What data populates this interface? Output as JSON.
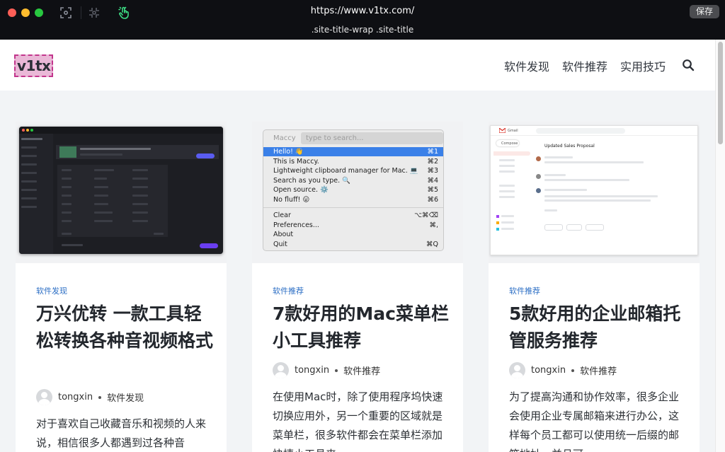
{
  "toolbar": {
    "url": "https://www.v1tx.com/",
    "selector": ".site-title-wrap .site-title",
    "save_label": "保存"
  },
  "site": {
    "logo": "v1tx",
    "nav": [
      "软件发现",
      "软件推荐",
      "实用技巧"
    ]
  },
  "colors": {
    "accent": "#2a6dc4",
    "highlight": "#c2358c",
    "topbar": "#0e0f13"
  },
  "cards": [
    {
      "category": "软件发现",
      "title": "万兴优转 一款工具轻松转换各种音视频格式",
      "author": "tongxin",
      "meta_category": "软件发现",
      "excerpt": "对于喜欢自己收藏音乐和视频的人来说，相信很多人都遇到过各种音"
    },
    {
      "category": "软件推荐",
      "title": "7款好用的Mac菜单栏小工具推荐",
      "author": "tongxin",
      "meta_category": "软件推荐",
      "excerpt": "在使用Mac时，除了使用程序坞快速切换应用外，另一个重要的区域就是菜单栏，很多软件都会在菜单栏添加快捷小工具来"
    },
    {
      "category": "软件推荐",
      "title": "5款好用的企业邮箱托管服务推荐",
      "author": "tongxin",
      "meta_category": "软件推荐",
      "excerpt": "为了提高沟通和协作效率，很多企业会使用企业专属邮箱来进行办公，这样每个员工都可以使用统一后缀的邮箱地址，并且可"
    }
  ],
  "maccy": {
    "app_name": "Maccy",
    "search_placeholder": "type to search...",
    "items": [
      {
        "label": "Hello! 👋",
        "shortcut": "⌘1"
      },
      {
        "label": "This is Maccy.",
        "shortcut": "⌘2"
      },
      {
        "label": "Lightweight clipboard manager for Mac. 💻",
        "shortcut": "⌘3"
      },
      {
        "label": "Search as you type. 🔍",
        "shortcut": "⌘4"
      },
      {
        "label": "Open source. ⚙️",
        "shortcut": "⌘5"
      },
      {
        "label": "No fluff! 😛",
        "shortcut": "⌘6"
      }
    ],
    "actions": [
      {
        "label": "Clear",
        "shortcut": "⌥⌘⌫"
      },
      {
        "label": "Preferences...",
        "shortcut": "⌘,"
      },
      {
        "label": "About",
        "shortcut": ""
      },
      {
        "label": "Quit",
        "shortcut": "⌘Q"
      }
    ]
  },
  "gmail": {
    "brand": "Gmail",
    "compose": "Compose",
    "subject": "Updated Sales Proposal"
  }
}
